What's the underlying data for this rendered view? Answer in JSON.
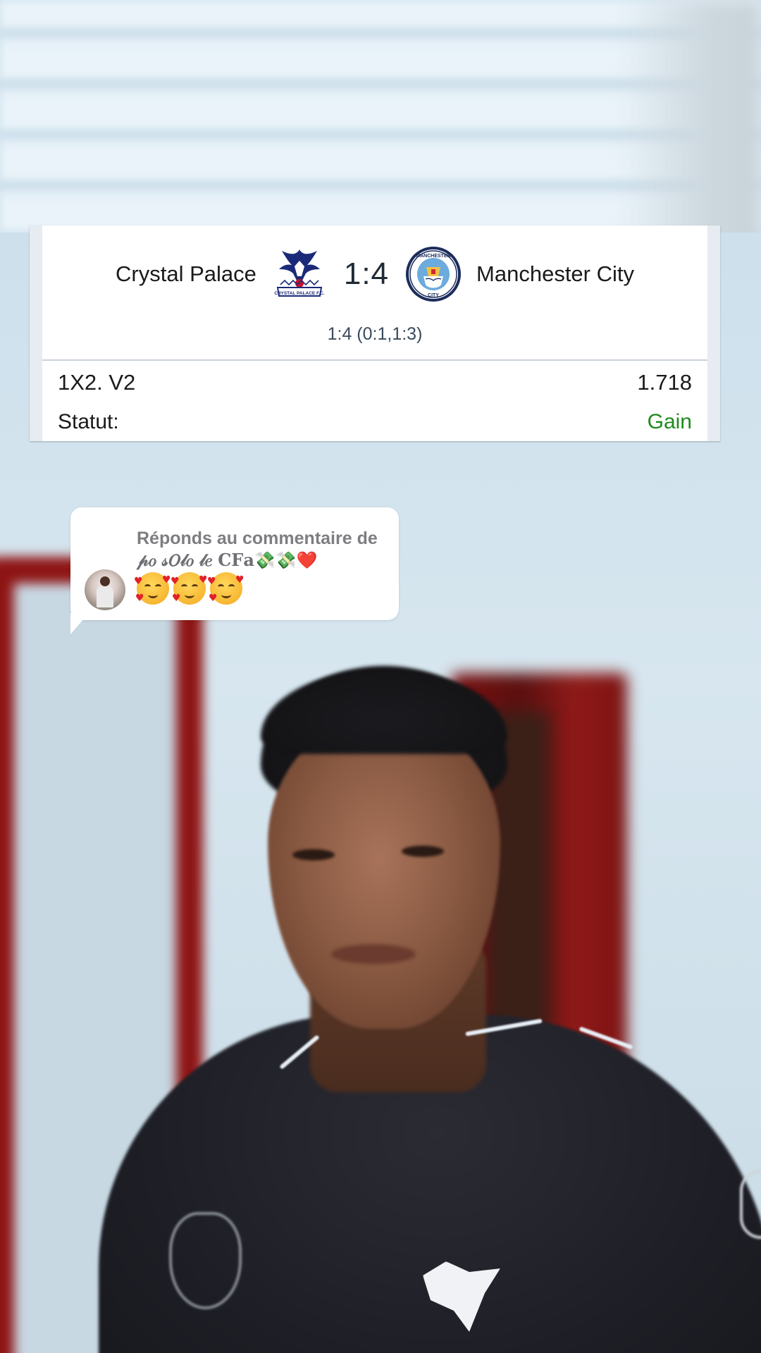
{
  "bet_card": {
    "home_team": "Crystal Palace",
    "away_team": "Manchester City",
    "score": "1:4",
    "score_detail": "1:4 (0:1,1:3)",
    "market": "1X2. V2",
    "odds": "1.718",
    "status_label": "Statut:",
    "status_value": "Gain",
    "status_color": "#1f8b1c",
    "home_logo_icon": "crystal-palace-crest",
    "away_logo_icon": "manchester-city-crest",
    "home_logo_text": "CRYSTAL PALACE F.C.",
    "away_logo_text": "MANCHESTER CITY"
  },
  "reply_bubble": {
    "title": "Réponds au commentaire de",
    "username": "𝓅𝑜 𝓈𝑂𝓁𝑜 𝓁𝑒 𝐂𝐅𝐚💸💸❤️",
    "emojis": [
      "smiling-face-with-hearts",
      "smiling-face-with-hearts",
      "smiling-face-with-hearts"
    ]
  }
}
